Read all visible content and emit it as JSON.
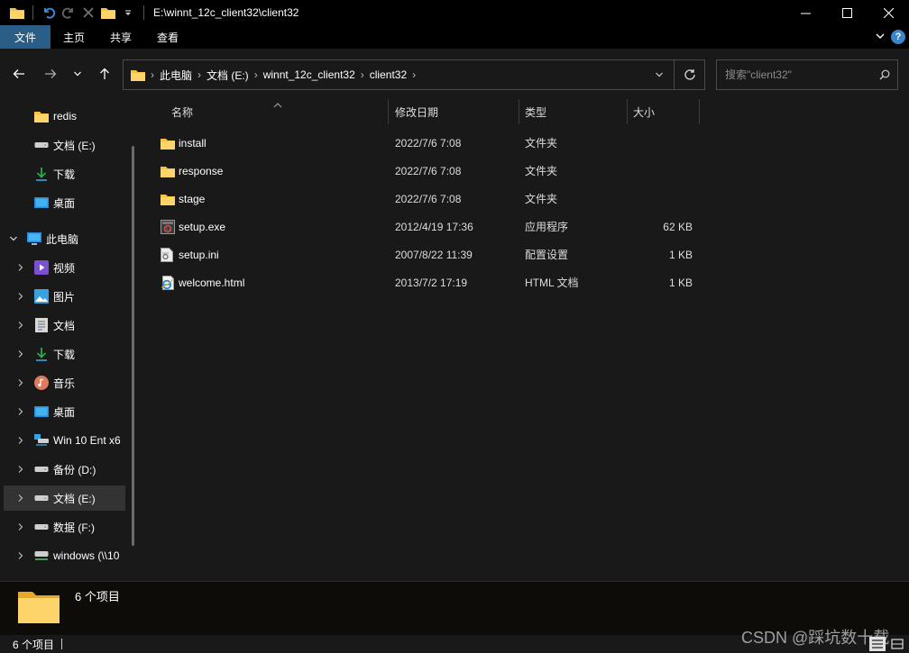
{
  "window": {
    "title": "E:\\winnt_12c_client32\\client32"
  },
  "ribbon": {
    "tabs": [
      "文件",
      "主页",
      "共享",
      "查看"
    ]
  },
  "address": {
    "crumbs": [
      "此电脑",
      "文档 (E:)",
      "winnt_12c_client32",
      "client32"
    ]
  },
  "search": {
    "placeholder": "搜索\"client32\""
  },
  "sidebar": {
    "items": [
      {
        "label": "redis",
        "icon": "folder-icon"
      },
      {
        "label": "文档 (E:)",
        "icon": "drive-icon"
      },
      {
        "label": "下载",
        "icon": "download-icon"
      },
      {
        "label": "桌面",
        "icon": "desktop-icon"
      },
      {
        "label": "此电脑",
        "icon": "computer-icon"
      },
      {
        "label": "视频",
        "icon": "video-icon"
      },
      {
        "label": "图片",
        "icon": "pictures-icon"
      },
      {
        "label": "文档",
        "icon": "documents-icon"
      },
      {
        "label": "下载",
        "icon": "download-icon"
      },
      {
        "label": "音乐",
        "icon": "music-icon"
      },
      {
        "label": "桌面",
        "icon": "desktop-icon"
      },
      {
        "label": "Win 10 Ent x6",
        "icon": "network-drive-icon"
      },
      {
        "label": "备份 (D:)",
        "icon": "drive-icon"
      },
      {
        "label": "文档 (E:)",
        "icon": "drive-icon"
      },
      {
        "label": "数据 (F:)",
        "icon": "drive-icon"
      },
      {
        "label": "windows (\\\\10",
        "icon": "network-drive-icon"
      }
    ]
  },
  "columns": {
    "name": "名称",
    "modified": "修改日期",
    "type": "类型",
    "size": "大小"
  },
  "files": [
    {
      "name": "install",
      "modified": "2022/7/6 7:08",
      "type": "文件夹",
      "size": "",
      "icon": "folder-icon"
    },
    {
      "name": "response",
      "modified": "2022/7/6 7:08",
      "type": "文件夹",
      "size": "",
      "icon": "folder-icon"
    },
    {
      "name": "stage",
      "modified": "2022/7/6 7:08",
      "type": "文件夹",
      "size": "",
      "icon": "folder-icon"
    },
    {
      "name": "setup.exe",
      "modified": "2012/4/19 17:36",
      "type": "应用程序",
      "size": "62 KB",
      "icon": "exe-icon"
    },
    {
      "name": "setup.ini",
      "modified": "2007/8/22 11:39",
      "type": "配置设置",
      "size": "1 KB",
      "icon": "ini-file-icon"
    },
    {
      "name": "welcome.html",
      "modified": "2013/7/2 17:19",
      "type": "HTML 文档",
      "size": "1 KB",
      "icon": "html-file-icon"
    }
  ],
  "details": {
    "count": "6 个项目"
  },
  "status": {
    "count": "6 个项目"
  },
  "watermark": "CSDN @踩坑数十载",
  "colors": {
    "folder": "#f5c242",
    "selected_tab": "#2b5e86",
    "background": "#191919"
  }
}
